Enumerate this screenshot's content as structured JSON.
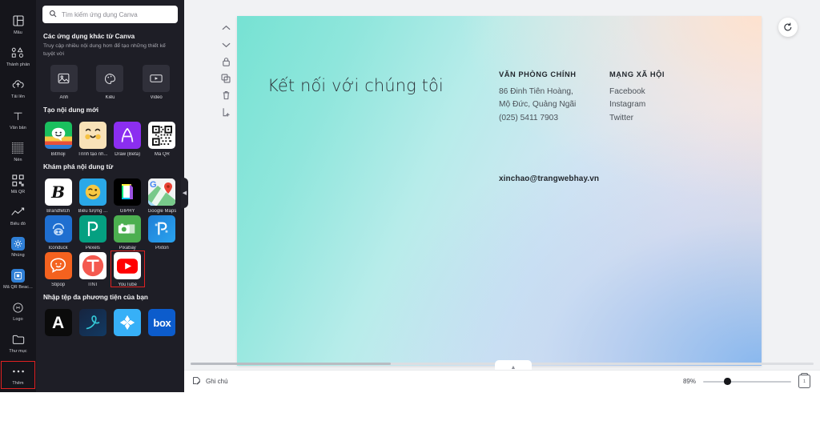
{
  "rail": {
    "items": [
      {
        "label": "Mẫu",
        "icon": "template-icon",
        "active": false
      },
      {
        "label": "Thành phần",
        "icon": "elements-icon",
        "active": false
      },
      {
        "label": "Tải lên",
        "icon": "upload-cloud-icon",
        "active": false
      },
      {
        "label": "Văn bản",
        "icon": "text-t-icon",
        "active": false
      },
      {
        "label": "Nền",
        "icon": "background-grid-icon",
        "active": false
      },
      {
        "label": "Mã QR",
        "icon": "qr-code-icon",
        "active": false
      },
      {
        "label": "Biểu đồ",
        "icon": "chart-line-icon",
        "active": false
      },
      {
        "label": "Nhúng",
        "icon": "embed-icon",
        "active": true
      },
      {
        "label": "Mã QR Beac...",
        "icon": "qr-beacon-icon",
        "active": true
      },
      {
        "label": "Logo",
        "icon": "logo-circle-icon",
        "active": false
      },
      {
        "label": "Thư mục",
        "icon": "folder-icon",
        "active": false
      },
      {
        "label": "Thêm",
        "icon": "more-dots-icon",
        "active": false
      }
    ]
  },
  "panel": {
    "search_placeholder": "Tìm kiếm ứng dụng Canva",
    "search_value": "",
    "sections": [
      {
        "title": "Các ứng dụng khác từ Canva",
        "subtitle": "Truy cập nhiều nội dung hơn để tạo những thiết kế tuyệt vời",
        "apps": [
          {
            "label": "Ảnh",
            "icon": "photo-icon",
            "style": "flat"
          },
          {
            "label": "Kiểu",
            "icon": "palette-icon",
            "style": "flat"
          },
          {
            "label": "Video",
            "icon": "video-icon",
            "style": "flat"
          }
        ]
      },
      {
        "title": "Tạo nội dung mới",
        "subtitle": "",
        "apps": [
          {
            "label": "Bitmoji",
            "icon": "bitmoji-icon",
            "style": "brand"
          },
          {
            "label": "Trình tạo nh...",
            "icon": "avatar-maker-icon",
            "style": "brand"
          },
          {
            "label": "Draw (Beta)",
            "icon": "draw-icon",
            "style": "brand"
          },
          {
            "label": "Mã QR",
            "icon": "qr-app-icon",
            "style": "brand"
          }
        ]
      },
      {
        "title": "Khám phá nội dung từ",
        "subtitle": "",
        "apps": [
          {
            "label": "Brandfetch",
            "icon": "brandfetch-icon",
            "style": "brand"
          },
          {
            "label": "Biểu tượng ...",
            "icon": "emoji-icon",
            "style": "brand"
          },
          {
            "label": "GIPHY",
            "icon": "giphy-icon",
            "style": "brand"
          },
          {
            "label": "Google Maps",
            "icon": "google-maps-icon",
            "style": "brand"
          },
          {
            "label": "Iconduck",
            "icon": "iconduck-icon",
            "style": "brand"
          },
          {
            "label": "Pexels",
            "icon": "pexels-icon",
            "style": "brand"
          },
          {
            "label": "Pixabay",
            "icon": "pixabay-icon",
            "style": "brand"
          },
          {
            "label": "Pixton",
            "icon": "pixton-icon",
            "style": "brand"
          },
          {
            "label": "Stipop",
            "icon": "stipop-icon",
            "style": "brand"
          },
          {
            "label": "TINT",
            "icon": "tint-icon",
            "style": "brand"
          },
          {
            "label": "YouTube",
            "icon": "youtube-icon",
            "style": "brand",
            "highlighted": true
          }
        ]
      },
      {
        "title": "Nhập tệp đa phương tiện của bạn",
        "subtitle": "",
        "apps": [
          {
            "label": "",
            "icon": "adobe-a-icon",
            "style": "brand"
          },
          {
            "label": "",
            "icon": "swirl-icon",
            "style": "brand"
          },
          {
            "label": "",
            "icon": "dropbox-icon",
            "style": "brand"
          },
          {
            "label": "",
            "icon": "box-icon",
            "style": "brand"
          }
        ]
      }
    ]
  },
  "page": {
    "title": "Kết nối với chúng tôi",
    "columns": [
      {
        "heading": "VĂN PHÒNG CHÍNH",
        "lines": [
          "86 Đinh Tiên Hoàng,",
          "Mộ Đức, Quảng Ngãi",
          "(025) 5411 7903"
        ]
      },
      {
        "heading": "MẠNG XÃ HỘI",
        "lines": [
          "Facebook",
          "Instagram",
          "Twitter"
        ]
      }
    ],
    "email": "xinchao@trangwebhay.vn",
    "page_number": "1"
  },
  "page_tools": [
    {
      "name": "move-up-icon"
    },
    {
      "name": "move-down-icon"
    },
    {
      "name": "lock-icon"
    },
    {
      "name": "duplicate-icon"
    },
    {
      "name": "trash-icon"
    },
    {
      "name": "add-page-icon"
    }
  ],
  "animate": {
    "icon": "animate-rotate-icon"
  },
  "bottom": {
    "notes_label": "Ghi chú",
    "zoom_value": "89%",
    "zoom_percent": 89,
    "pages_count": "1"
  },
  "colors": {
    "panel_bg": "#1e1e26",
    "rail_bg": "#15151b",
    "highlight": "#e02121",
    "accent_blue": "#2f7fd6",
    "editor_bg": "#f1f2f4"
  }
}
